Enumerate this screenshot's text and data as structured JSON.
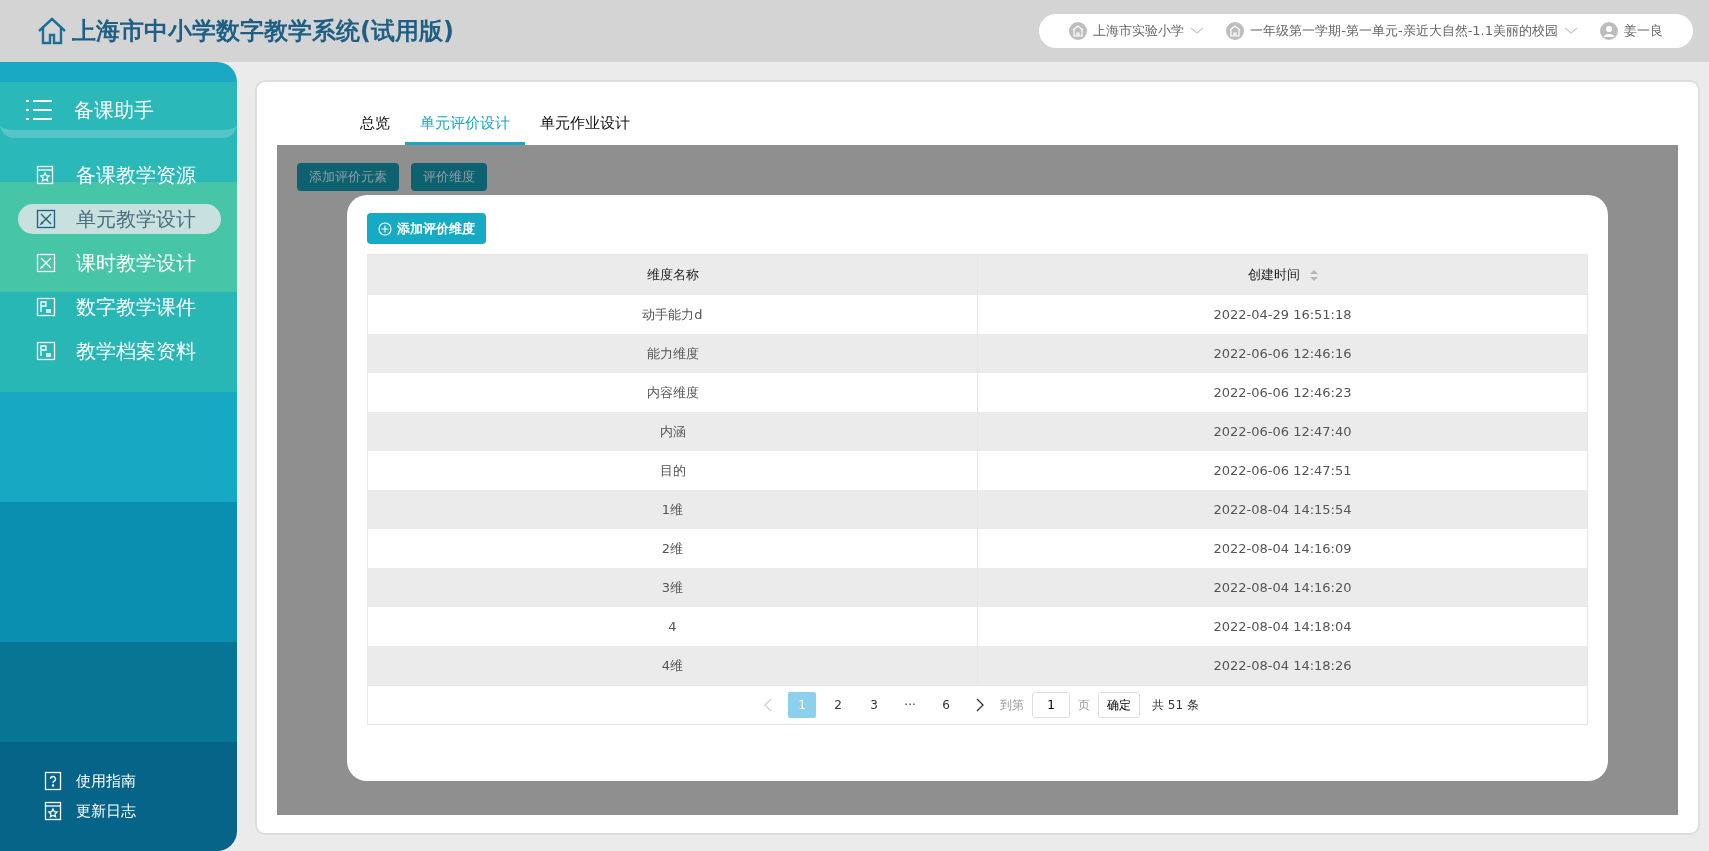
{
  "header": {
    "title": "上海市中小学数字教学系统(试用版)",
    "selectors": [
      {
        "label": "上海市实验小学",
        "kind": "dropdown"
      },
      {
        "label": "一年级第一学期-第一单元-亲近大自然-1.1美丽的校园",
        "kind": "dropdown"
      },
      {
        "label": "姜一良",
        "kind": "user"
      }
    ]
  },
  "sidebar": {
    "title": "备课助手",
    "items": [
      {
        "label": "备课教学资源",
        "kind": "book",
        "selected": false
      },
      {
        "label": "单元教学设计",
        "kind": "tools",
        "selected": true
      },
      {
        "label": "课时教学设计",
        "kind": "tools",
        "selected": false
      },
      {
        "label": "数字教学课件",
        "kind": "slide",
        "selected": false
      },
      {
        "label": "教学档案资料",
        "kind": "slide",
        "selected": false
      }
    ],
    "footer": [
      {
        "label": "使用指南",
        "kind": "help"
      },
      {
        "label": "更新日志",
        "kind": "book"
      }
    ]
  },
  "tabs": [
    {
      "label": "总览",
      "selected": false
    },
    {
      "label": "单元评价设计",
      "selected": true
    },
    {
      "label": "单元作业设计",
      "selected": false
    }
  ],
  "toolbar": [
    "添加评价元素",
    "评价维度"
  ],
  "dialog": {
    "add_button": "添加评价维度",
    "table": {
      "columns": [
        {
          "label": "维度名称",
          "sortable": false
        },
        {
          "label": "创建时间",
          "sortable": true
        }
      ],
      "rows": [
        [
          "动手能力d",
          "2022-04-29 16:51:18"
        ],
        [
          "能力维度",
          "2022-06-06 12:46:16"
        ],
        [
          "内容维度",
          "2022-06-06 12:46:23"
        ],
        [
          "内涵",
          "2022-06-06 12:47:40"
        ],
        [
          "目的",
          "2022-06-06 12:47:51"
        ],
        [
          "1维",
          "2022-08-04 14:15:54"
        ],
        [
          "2维",
          "2022-08-04 14:16:09"
        ],
        [
          "3维",
          "2022-08-04 14:16:20"
        ],
        [
          "4",
          "2022-08-04 14:18:04"
        ],
        [
          "4维",
          "2022-08-04 14:18:26"
        ]
      ]
    },
    "pagination": {
      "prev_disabled": true,
      "pages": [
        {
          "label": "1",
          "selected": true
        },
        {
          "label": "2",
          "selected": false
        },
        {
          "label": "3",
          "selected": false
        },
        {
          "label": "···",
          "selected": false
        },
        {
          "label": "6",
          "selected": false
        }
      ],
      "goto_label": "到第",
      "page_value": "1",
      "page_suffix": "页",
      "confirm": "确定",
      "total": "共 51 条"
    }
  }
}
